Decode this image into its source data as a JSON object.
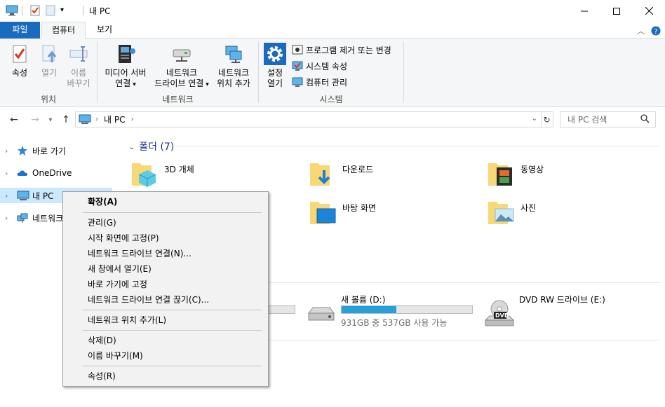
{
  "window": {
    "title": "내 PC",
    "controls": [
      "minimize",
      "maximize",
      "close"
    ]
  },
  "ribbon_tabs": {
    "file": "파일",
    "computer": "컴퓨터",
    "view": "보기"
  },
  "ribbon": {
    "location_group": {
      "label": "위치",
      "properties": "속성",
      "open": "열기",
      "rename_line1": "이름",
      "rename_line2": "바꾸기"
    },
    "network_group": {
      "label": "네트워크",
      "media_server_line1": "미디어 서버",
      "media_server_line2": "연결",
      "map_drive_line1": "네트워크",
      "map_drive_line2": "드라이브 연결",
      "add_location_line1": "네트워크",
      "add_location_line2": "위치 추가"
    },
    "system_group": {
      "label": "시스템",
      "settings_line1": "설정",
      "settings_line2": "열기",
      "uninstall": "프로그램 제거 또는 변경",
      "system_properties": "시스템 속성",
      "manage": "컴퓨터 관리"
    }
  },
  "address": {
    "path": "내 PC",
    "search_placeholder": "내 PC 검색"
  },
  "nav_pane": {
    "items": [
      {
        "label": "바로 가기",
        "icon": "star-icon"
      },
      {
        "label": "OneDrive",
        "icon": "cloud-icon"
      },
      {
        "label": "내 PC",
        "icon": "computer-icon"
      },
      {
        "label": "네트워크",
        "icon": "network-icon"
      }
    ]
  },
  "folders_group": {
    "title": "폴더 (7)",
    "items": [
      {
        "name": "3D 개체"
      },
      {
        "name": "다운로드"
      },
      {
        "name": "동영상"
      },
      {
        "name": "바탕 화면"
      },
      {
        "name": "사진"
      }
    ]
  },
  "drives": [
    {
      "name": "새 볼륨 (D:)",
      "detail": "931GB 중 537GB 사용 가능",
      "used_fraction": 0.42
    },
    {
      "name": "DVD RW 드라이브 (E:)",
      "icon_text": "DVD"
    }
  ],
  "context_menu": {
    "items": [
      {
        "label": "확장(A)",
        "bold": true
      },
      {
        "label": "관리(G)"
      },
      {
        "label": "시작 화면에 고정(P)"
      },
      {
        "label": "네트워크 드라이브 연결(N)..."
      },
      {
        "label": "새 창에서 열기(E)"
      },
      {
        "label": "바로 가기에 고정"
      },
      {
        "label": "네트워크 드라이브 연결 끊기(C)..."
      },
      {
        "label": "네트워크 위치 추가(L)"
      },
      {
        "label": "삭제(D)"
      },
      {
        "label": "이름 바꾸기(M)"
      },
      {
        "label": "속성(R)"
      }
    ]
  },
  "colors": {
    "accent": "#1a6bbf",
    "selection": "#cce8ff",
    "group_header": "#1e3287",
    "drive_bar": "#26a0da"
  }
}
